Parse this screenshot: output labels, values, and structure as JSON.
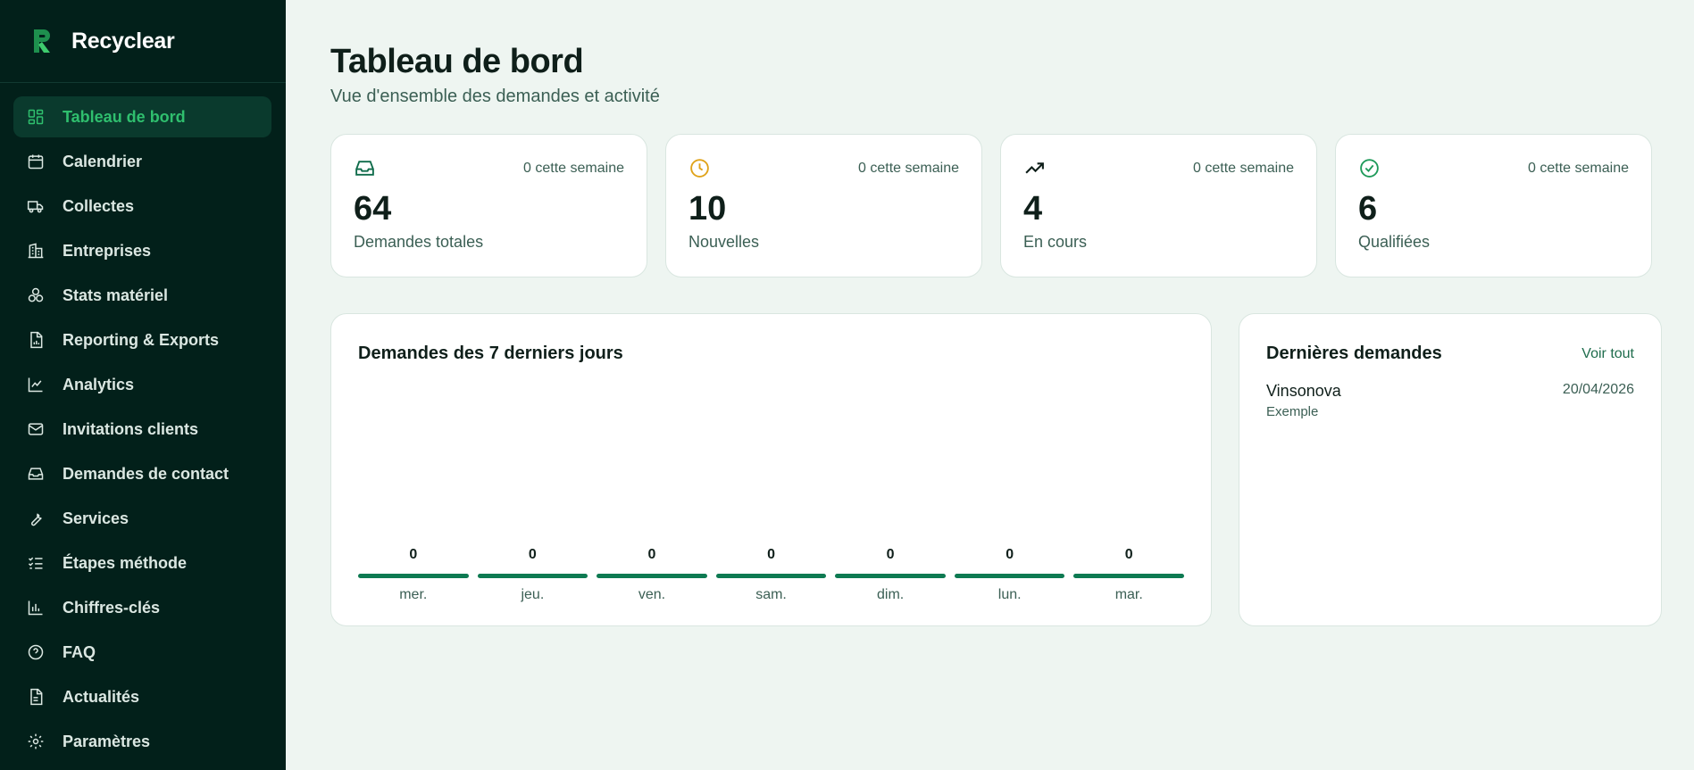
{
  "brand": {
    "name": "Recyclear"
  },
  "sidebar": {
    "items": [
      {
        "label": "Tableau de bord",
        "icon": "dashboard-icon",
        "active": true
      },
      {
        "label": "Calendrier",
        "icon": "calendar-icon"
      },
      {
        "label": "Collectes",
        "icon": "truck-icon"
      },
      {
        "label": "Entreprises",
        "icon": "building-icon"
      },
      {
        "label": "Stats matériel",
        "icon": "recycle-icon"
      },
      {
        "label": "Reporting & Exports",
        "icon": "file-chart-icon"
      },
      {
        "label": "Analytics",
        "icon": "line-chart-icon"
      },
      {
        "label": "Invitations clients",
        "icon": "mail-icon"
      },
      {
        "label": "Demandes de contact",
        "icon": "inbox-icon"
      },
      {
        "label": "Services",
        "icon": "wrench-icon"
      },
      {
        "label": "Étapes méthode",
        "icon": "list-checks-icon"
      },
      {
        "label": "Chiffres-clés",
        "icon": "bar-chart-icon"
      },
      {
        "label": "FAQ",
        "icon": "help-circle-icon"
      },
      {
        "label": "Actualités",
        "icon": "document-icon"
      },
      {
        "label": "Paramètres",
        "icon": "gear-icon"
      }
    ]
  },
  "header": {
    "title": "Tableau de bord",
    "subtitle": "Vue d'ensemble des demandes et activité"
  },
  "stats": [
    {
      "value": "64",
      "label": "Demandes totales",
      "week": "0 cette semaine",
      "icon": "inbox-icon",
      "color": "#0e6b4a"
    },
    {
      "value": "10",
      "label": "Nouvelles",
      "week": "0 cette semaine",
      "icon": "clock-icon",
      "color": "#e0a31a"
    },
    {
      "value": "4",
      "label": "En cours",
      "week": "0 cette semaine",
      "icon": "trending-up-icon",
      "color": "#0f1f1a"
    },
    {
      "value": "6",
      "label": "Qualifiées",
      "week": "0 cette semaine",
      "icon": "check-circle-icon",
      "color": "#1f9a5a"
    }
  ],
  "chart": {
    "title": "Demandes des 7 derniers jours"
  },
  "chart_data": {
    "type": "bar",
    "title": "Demandes des 7 derniers jours",
    "categories": [
      "mer.",
      "jeu.",
      "ven.",
      "sam.",
      "dim.",
      "lun.",
      "mar."
    ],
    "values": [
      0,
      0,
      0,
      0,
      0,
      0,
      0
    ],
    "color": "#0e7a52"
  },
  "recent": {
    "title": "Dernières demandes",
    "see_all": "Voir tout",
    "items": [
      {
        "name": "Vinsonova",
        "sub": "Exemple",
        "date": "20/04/2026"
      }
    ]
  }
}
